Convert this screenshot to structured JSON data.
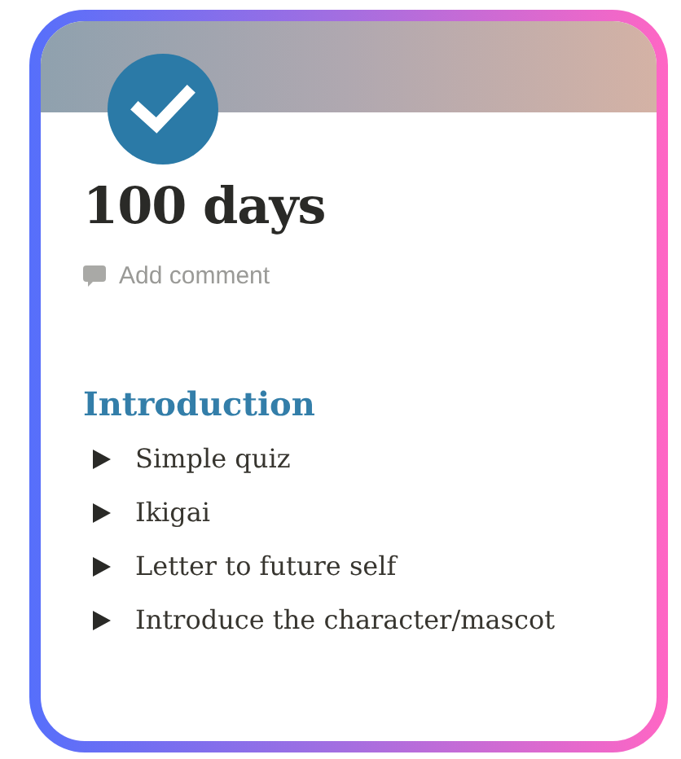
{
  "page": {
    "title": "100 days",
    "comment_action": "Add comment"
  },
  "section": {
    "heading": "Introduction",
    "toggles": [
      {
        "label": "Simple quiz"
      },
      {
        "label": "Ikigai"
      },
      {
        "label": "Letter to future self"
      },
      {
        "label": "Introduce the character/mascot"
      }
    ]
  }
}
